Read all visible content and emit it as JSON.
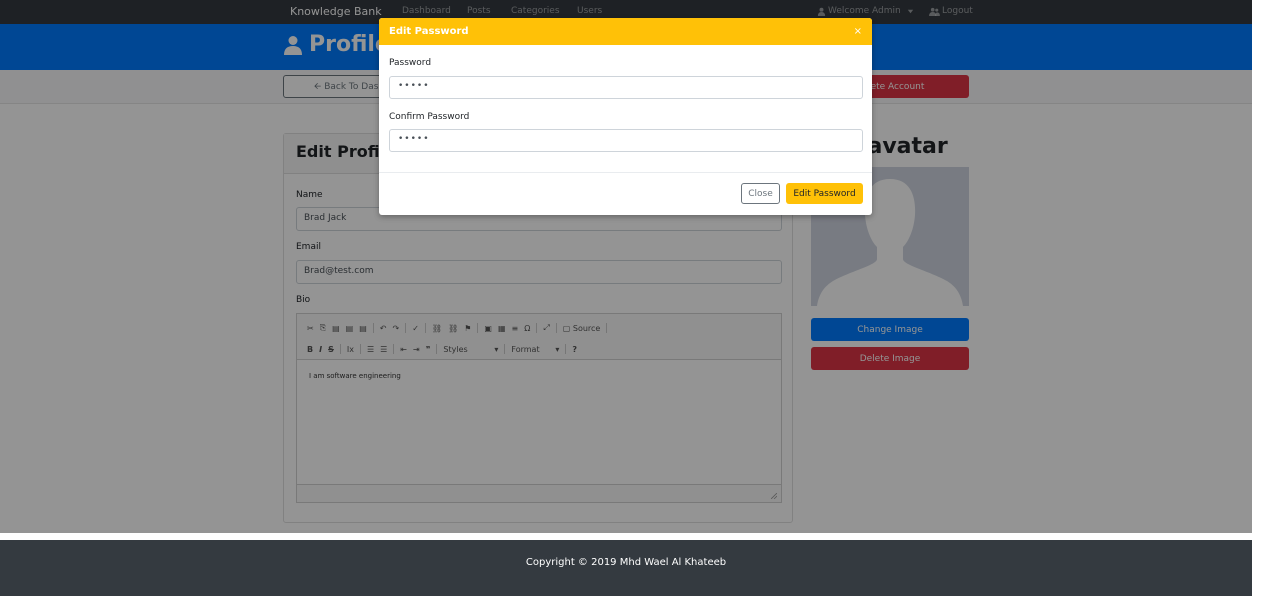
{
  "navbar": {
    "brand": "Knowledge Bank",
    "links": [
      "Dashboard",
      "Posts",
      "Categories",
      "Users"
    ],
    "welcome": "Welcome Admin",
    "logout": "Logout"
  },
  "header": {
    "title": "Profile"
  },
  "actions": {
    "back_label": "Back To Dashboard",
    "delete_account_label": "Delete Account"
  },
  "edit_profile": {
    "title": "Edit Profile",
    "name_label": "Name",
    "name_value": "Brad Jack",
    "email_label": "Email",
    "email_value": "Brad@test.com",
    "bio_label": "Bio",
    "bio_text": "I am software engineering",
    "toolbar_source": "Source",
    "toolbar_styles": "Styles",
    "toolbar_format": "Format"
  },
  "avatar": {
    "title": "Edit avatar",
    "change_label": "Change Image",
    "delete_label": "Delete Image"
  },
  "footer": {
    "text": "Copyright © 2019 Mhd Wael Al Khateeb"
  },
  "modal": {
    "title": "Edit Password",
    "close_icon": "×",
    "password_label": "Password",
    "password_value": "•••••",
    "confirm_label": "Confirm Password",
    "confirm_value": "•••••",
    "close_label": "Close",
    "submit_label": "Edit Password"
  },
  "colors": {
    "primary": "#007bff",
    "danger": "#dc3545",
    "warning": "#ffc107",
    "dark": "#343a40"
  }
}
